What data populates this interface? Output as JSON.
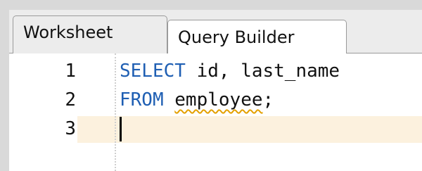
{
  "tabs": [
    {
      "label": "Worksheet"
    },
    {
      "label": "Query Builder"
    }
  ],
  "editor": {
    "line_numbers": [
      "1",
      "2",
      "3"
    ],
    "lines": [
      {
        "keyword1": "SELECT",
        "text1": " id, last_name"
      },
      {
        "keyword1": "FROM",
        "space": " ",
        "identifier": "employee",
        "text1": ";"
      },
      {
        "text1": ""
      }
    ]
  },
  "colors": {
    "keyword": "#1f5fb3",
    "current_line": "#fcf1de",
    "squiggle": "#e3a000"
  }
}
